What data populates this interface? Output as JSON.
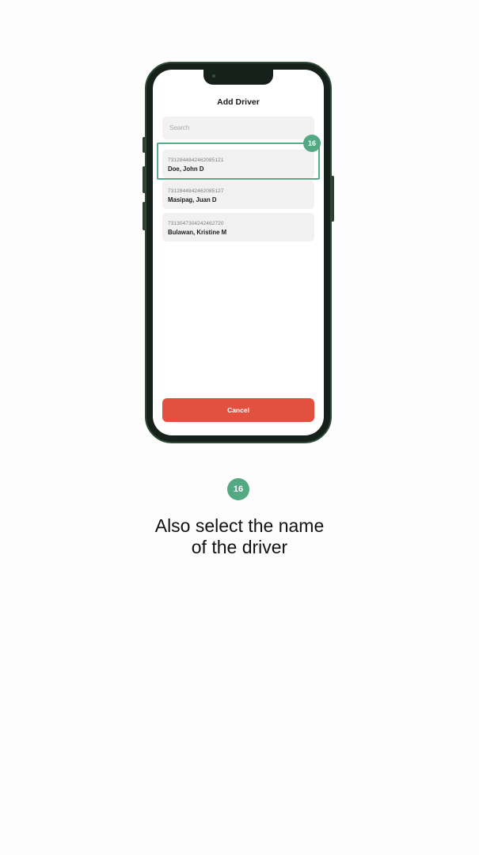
{
  "app": {
    "title": "Add Driver",
    "search_placeholder": "Search",
    "drivers": [
      {
        "id": "7312844842462085121",
        "name": "Doe, John D"
      },
      {
        "id": "7312844842462085127",
        "name": "Masipag, Juan D"
      },
      {
        "id": "7313047304242462720",
        "name": "Bulawan, Kristine M"
      }
    ],
    "cancel_label": "Cancel"
  },
  "guide": {
    "step_badge": "16",
    "instruction_line1": "Also select the name",
    "instruction_line2": "of the driver",
    "highlight_color": "#5aac88",
    "badge_color": "#52a982"
  },
  "colors": {
    "cancel_button": "#e2503f",
    "phone_frame": "#15211a"
  }
}
